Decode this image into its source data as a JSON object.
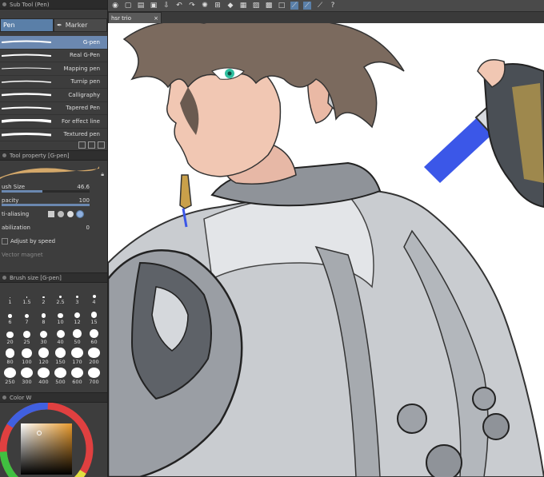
{
  "sub_tool": {
    "title": "Sub Tool (Pen)",
    "tabs": [
      "Pen",
      "Marker"
    ],
    "items": [
      "G-pen",
      "Real G-Pen",
      "Mapping pen",
      "Turnip pen",
      "Calligraphy",
      "Tapered Pen",
      "For effect line",
      "Textured pen"
    ],
    "selected_index": 0
  },
  "tool_property": {
    "title": "Tool property [G-pen]",
    "brush_size_label": "ush Size",
    "brush_size_value": "46.6",
    "opacity_label": "pacity",
    "opacity_value": "100",
    "aa_label": "ti-aliasing",
    "stabilization_label": "abilization",
    "stabilization_value": "0",
    "adjust_speed_label": "Adjust by speed",
    "vector_magnet_label": "Vector magnet",
    "brush_size_fraction": 0.46,
    "opacity_fraction": 1.0
  },
  "brush_size_panel": {
    "title": "Brush size [G-pen]",
    "sizes": [
      "1",
      "1.5",
      "2",
      "2.5",
      "3",
      "4",
      "6",
      "7",
      "8",
      "10",
      "12",
      "15",
      "20",
      "25",
      "30",
      "40",
      "50",
      "60",
      "80",
      "100",
      "120",
      "150",
      "170",
      "200",
      "250",
      "300",
      "400",
      "500",
      "600",
      "700"
    ]
  },
  "color_panel": {
    "title": "Color W"
  },
  "document": {
    "tab_title": "hsr trio"
  },
  "colors": {
    "accent": "#5a7fa8",
    "selected_item": "#6b88b0",
    "panel": "#3d3d3d",
    "brush_tan": "#d4a86a"
  }
}
